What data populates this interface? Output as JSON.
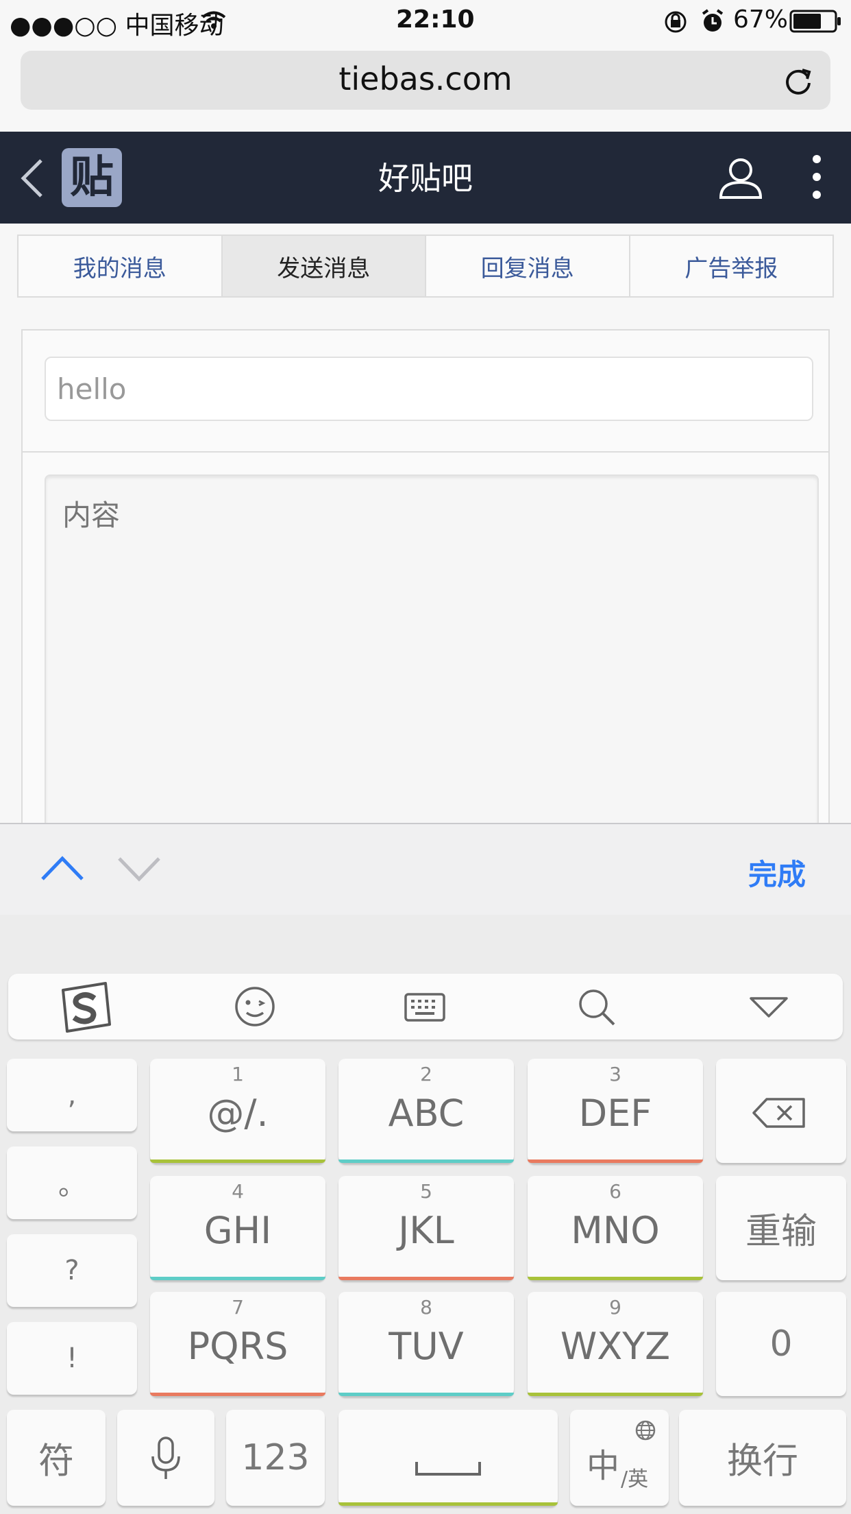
{
  "status_bar": {
    "carrier": "●●●○○ 中国移动",
    "time": "22:10",
    "battery": "67%"
  },
  "browser": {
    "url": "tiebas.com"
  },
  "header": {
    "logo_text": "贴",
    "title": "好贴吧"
  },
  "tabs": [
    {
      "label": "我的消息",
      "active": false
    },
    {
      "label": "发送消息",
      "active": true
    },
    {
      "label": "回复消息",
      "active": false
    },
    {
      "label": "广告举报",
      "active": false
    }
  ],
  "form": {
    "title_value": "hello",
    "content_placeholder": "内容"
  },
  "accessory": {
    "done_label": "完成"
  },
  "keyboard": {
    "punct": [
      ",",
      "。",
      "?",
      "!"
    ],
    "keys": [
      {
        "num": "1",
        "letters": "@/.",
        "color": "#a8c23a"
      },
      {
        "num": "2",
        "letters": "ABC",
        "color": "#5ecdc7"
      },
      {
        "num": "3",
        "letters": "DEF",
        "color": "#e97a5f"
      },
      {
        "num": "4",
        "letters": "GHI",
        "color": "#5ecdc7"
      },
      {
        "num": "5",
        "letters": "JKL",
        "color": "#e97a5f"
      },
      {
        "num": "6",
        "letters": "MNO",
        "color": "#a8c23a"
      },
      {
        "num": "7",
        "letters": "PQRS",
        "color": "#e97a5f"
      },
      {
        "num": "8",
        "letters": "TUV",
        "color": "#5ecdc7"
      },
      {
        "num": "9",
        "letters": "WXYZ",
        "color": "#a8c23a"
      }
    ],
    "reenter_label": "重输",
    "zero_label": "0",
    "symbol_label": "符",
    "num_label": "123",
    "lang_main": "中",
    "lang_sub": "/英",
    "newline_label": "换行",
    "space_bar_color": "#a8c23a"
  },
  "icons": [
    "wifi-icon",
    "rotation-lock-icon",
    "alarm-icon",
    "battery-icon",
    "reload-icon",
    "back-icon",
    "user-icon",
    "more-icon",
    "chevron-up-icon",
    "chevron-down-icon",
    "sogou-logo-icon",
    "emoji-icon",
    "keyboard-icon",
    "search-icon",
    "collapse-icon",
    "backspace-icon",
    "microphone-icon",
    "space-icon",
    "globe-icon"
  ]
}
